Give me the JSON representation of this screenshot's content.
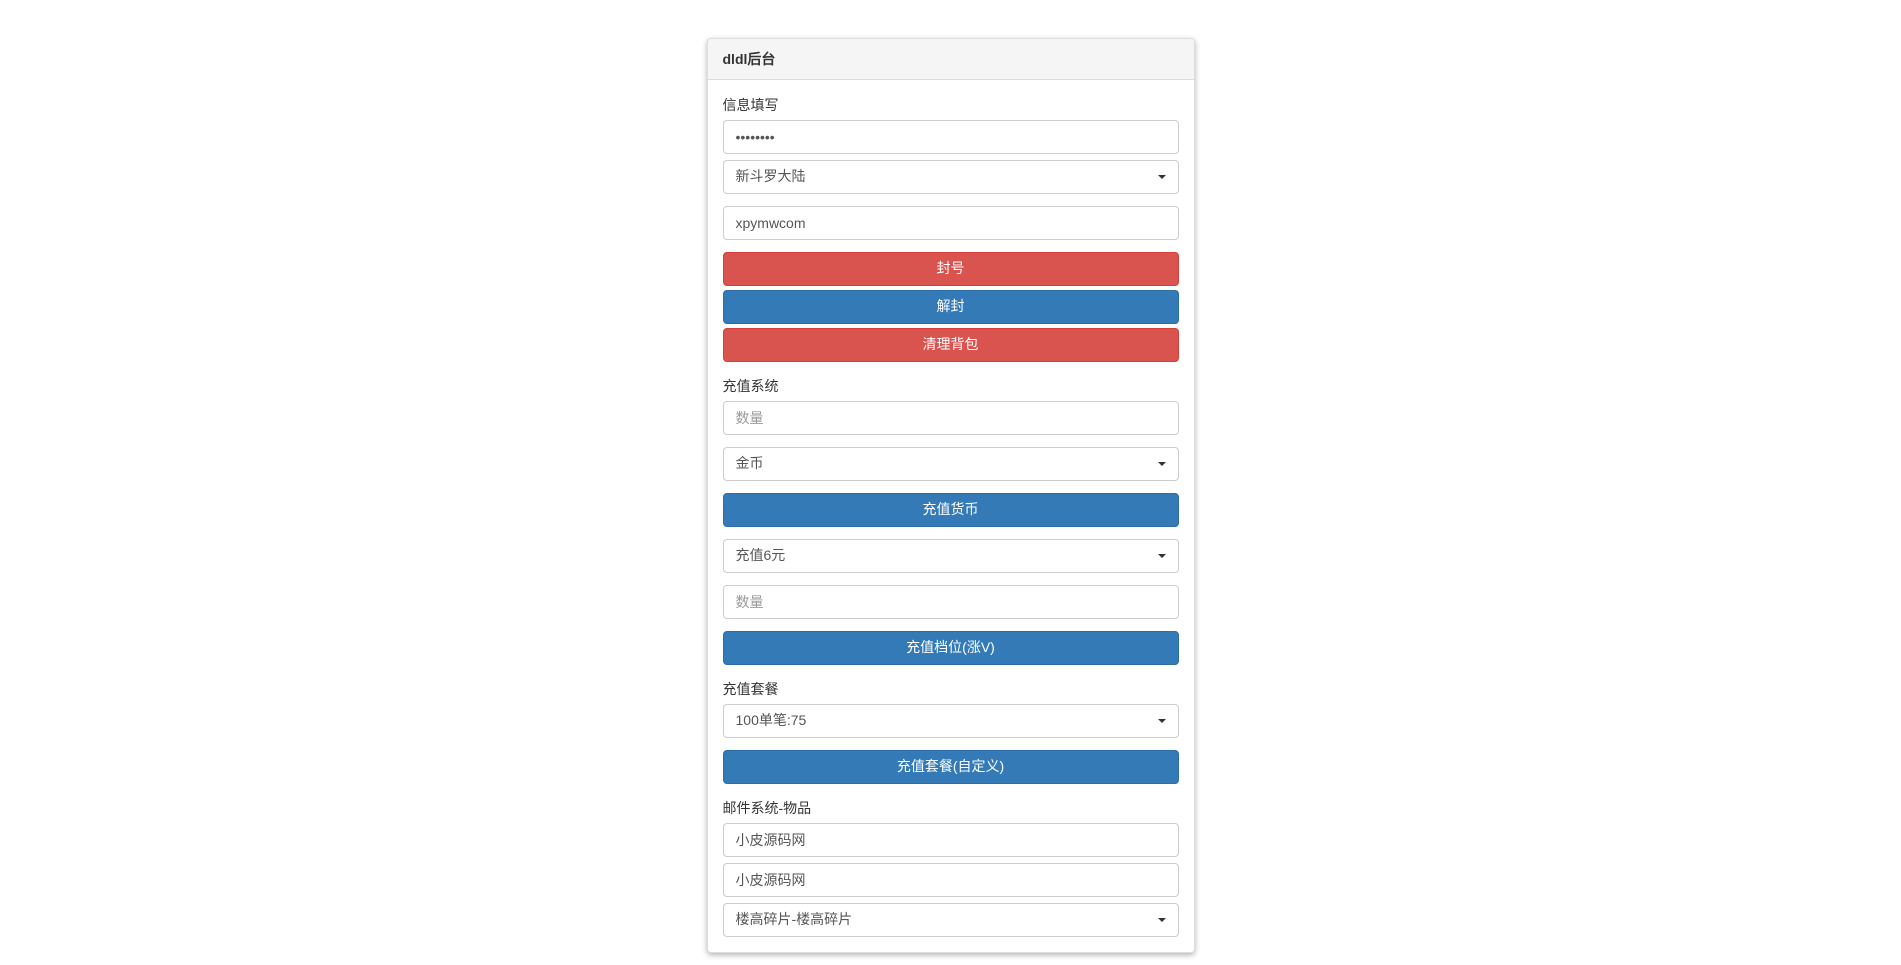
{
  "panel": {
    "title": "dldl后台"
  },
  "info": {
    "label": "信息填写",
    "password_value": "••••••••",
    "server_selected": "新斗罗大陆",
    "account_value": "xpymwcom"
  },
  "actions": {
    "ban": "封号",
    "unban": "解封",
    "clear_bag": "清理背包"
  },
  "recharge": {
    "label": "充值系统",
    "amount_placeholder": "数量",
    "currency_selected": "金币",
    "currency_button": "充值货币",
    "tier_selected": "充值6元",
    "tier_amount_placeholder": "数量",
    "tier_button": "充值档位(涨V)"
  },
  "recharge_pkg": {
    "label": "充值套餐",
    "selected": "100单笔:75",
    "button": "充值套餐(自定义)"
  },
  "mail": {
    "label": "邮件系统-物品",
    "input1_value": "小皮源码网",
    "input2_value": "小皮源码网",
    "item_selected": "楼高碎片-楼高碎片"
  }
}
